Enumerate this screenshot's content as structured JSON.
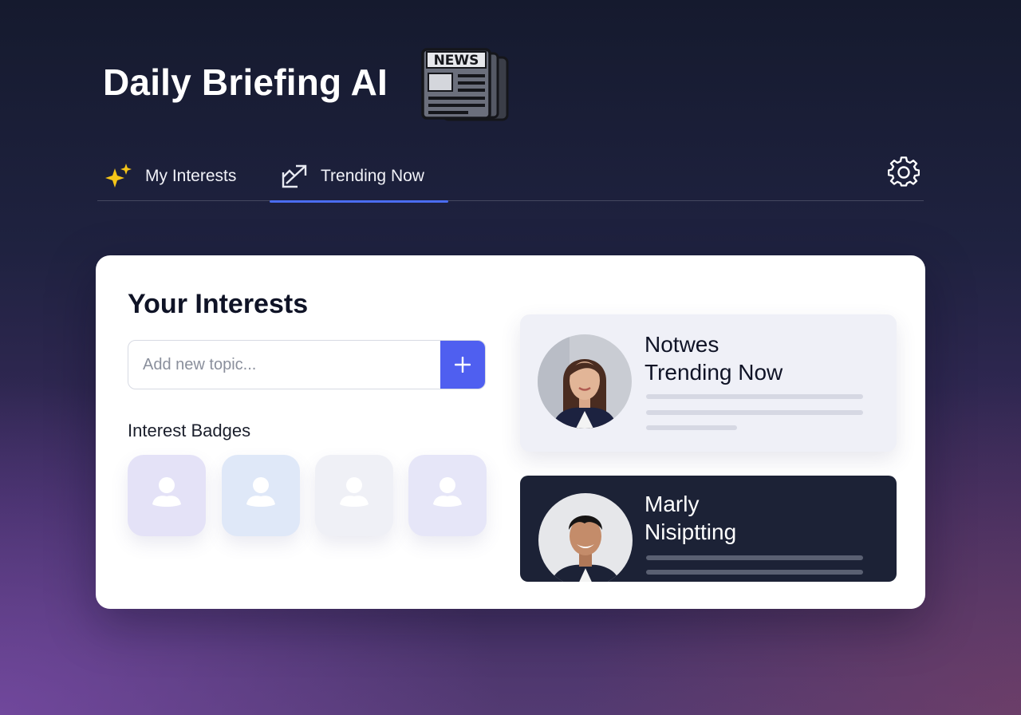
{
  "app": {
    "title": "Daily Briefing AI"
  },
  "header": {
    "news_icon": "newspaper-icon",
    "news_icon_text": "NEWS"
  },
  "tabs": [
    {
      "label": "My Interests",
      "icon": "sparkles-icon",
      "active": false
    },
    {
      "label": "Trending Now",
      "icon": "trending-arrow-icon",
      "active": true
    }
  ],
  "settings": {
    "icon": "gear-icon"
  },
  "interests": {
    "title": "Your Interests",
    "input": {
      "placeholder": "Add new topic...",
      "value": ""
    },
    "add_icon": "plus-icon",
    "badges_label": "Interest Badges",
    "badges": [
      {
        "icon": "user-icon",
        "color": "#e4e2f7"
      },
      {
        "icon": "user-icon",
        "color": "#dfe8f8"
      },
      {
        "icon": "user-icon",
        "color": "#eff0f6"
      },
      {
        "icon": "user-icon",
        "color": "#e6e6f8"
      }
    ]
  },
  "news": [
    {
      "title_line1": "Notwes",
      "title_line2": "Trending Now",
      "theme": "light",
      "avatar": "woman-portrait"
    },
    {
      "title_line1": "Marly",
      "title_line2": "Nisiptting",
      "theme": "dark",
      "avatar": "man-portrait"
    }
  ],
  "colors": {
    "accent": "#4f5ff0",
    "tab_underline": "#4a6cf0",
    "dark_card": "#1c2236",
    "sparkle": "#f5c518"
  }
}
